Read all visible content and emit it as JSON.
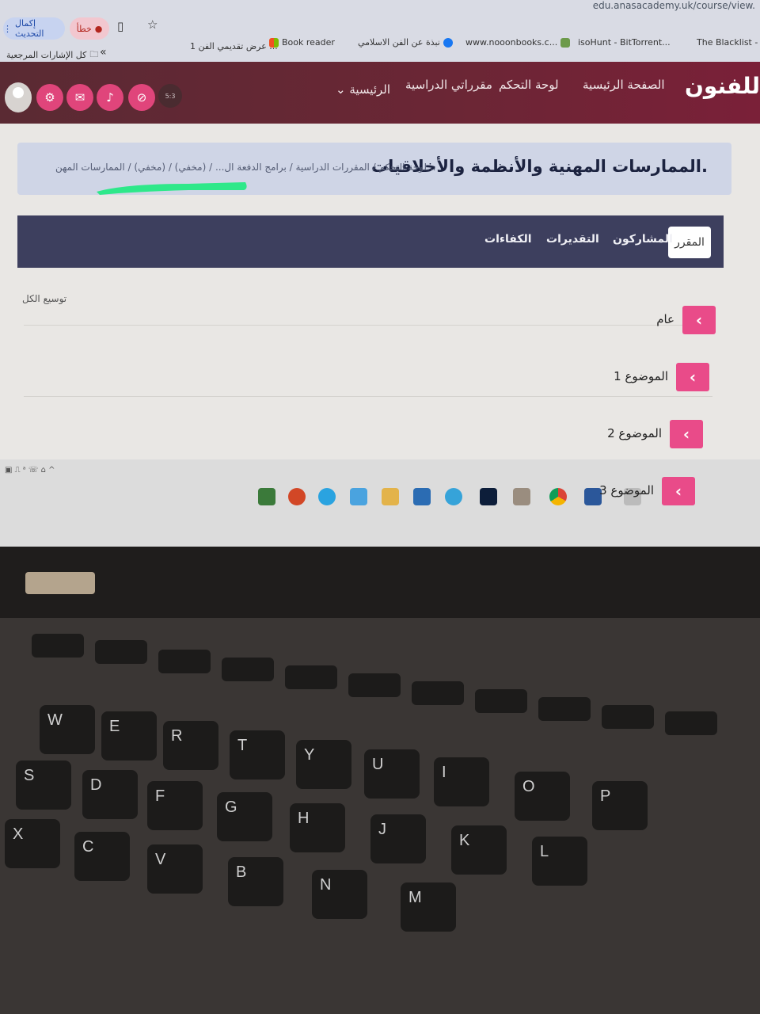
{
  "browser": {
    "url": "edu.anasacademy.uk/course/view.",
    "update_label": "إكمال التحديث",
    "error_label": "خطأ"
  },
  "bookmarks": {
    "all_bookmarks": "كل الإشارات المرجعية",
    "items": [
      "The Blacklist -",
      "isoHunt - BitTorrent...",
      "www.nooonbooks.c...",
      "نبذة عن الفن الاسلامي",
      "Book reader",
      "عرض تقديمي الفن 1 ..."
    ]
  },
  "nav": {
    "brand": "للفنون",
    "links": [
      "الصفحة الرئيسية",
      "لوحة التحكم",
      "مقرراتي الدراسية",
      "الرئيسية"
    ]
  },
  "course": {
    "title": "الممارسات المهنية والأنظمة والأخلاقيات.",
    "breadcrumb": "لوحة التحكم  /  المقررات الدراسية  /  برامج الدفعة ال...  /  (مخفي)  /  (مخفي)  /  الممارسات المهن..."
  },
  "tabs": [
    "المقرر",
    "المشاركون",
    "التقديرات",
    "الكفاءات"
  ],
  "expand_all": "توسيع الكل",
  "sections": [
    "عام",
    "الموضوع 1",
    "الموضوع 2",
    "الموضوع 3"
  ],
  "colors": {
    "navbar": "#6b2635",
    "accent_pink": "#e94b89",
    "tabbar": "#3d3f5e",
    "highlight_green": "#2ee88a"
  },
  "keyboard": {
    "row1": [
      "W",
      "E",
      "R",
      "T",
      "Y",
      "U",
      "I",
      "O",
      "P"
    ],
    "row2": [
      "S",
      "D",
      "F",
      "G",
      "H",
      "J",
      "K",
      "L"
    ],
    "row3": [
      "X",
      "C",
      "V",
      "B",
      "N",
      "M"
    ]
  }
}
